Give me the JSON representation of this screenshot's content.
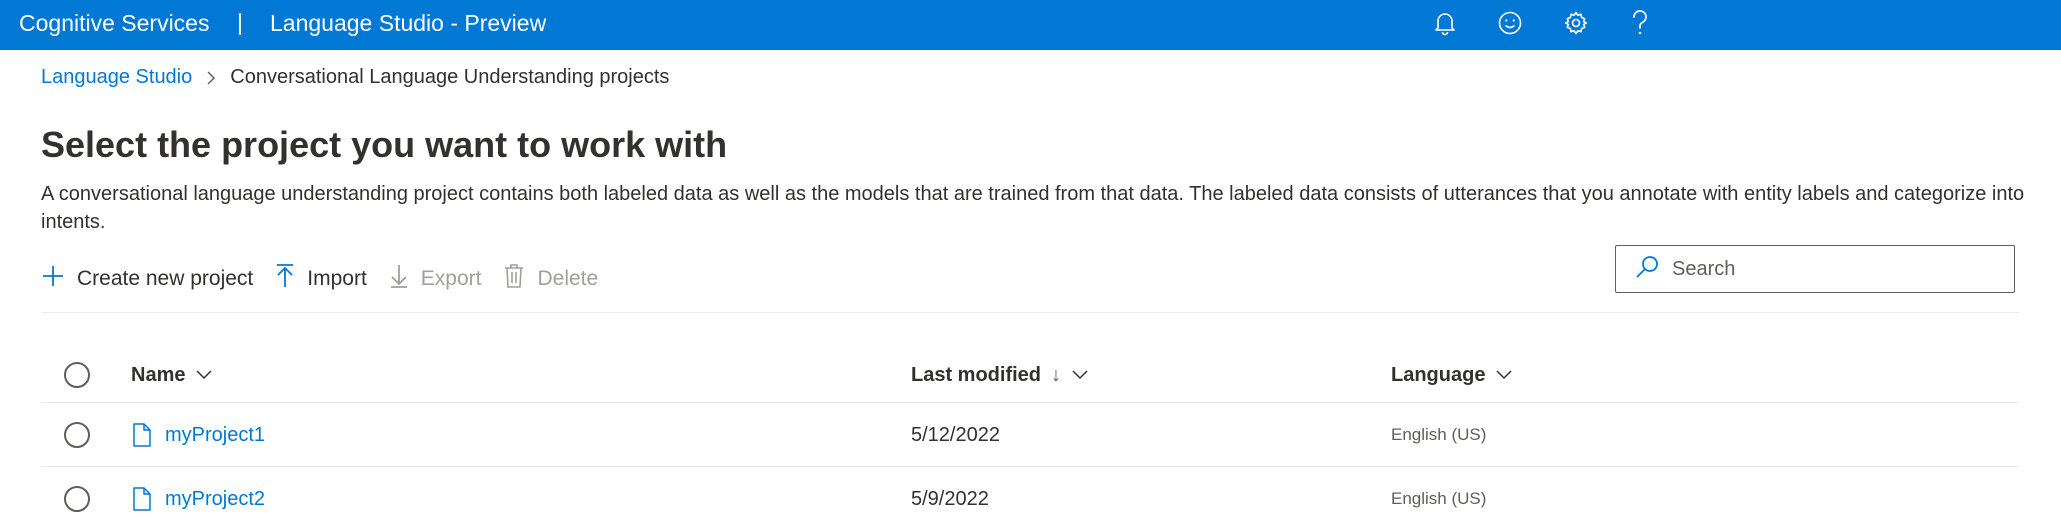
{
  "topbar": {
    "brand": "Cognitive Services",
    "divider": "|",
    "product": "Language Studio - Preview",
    "icons": [
      "bell-icon",
      "smiley-icon",
      "gear-icon",
      "help-icon"
    ],
    "background": "#0078d4"
  },
  "breadcrumb": {
    "root": "Language Studio",
    "current": "Conversational Language Understanding projects"
  },
  "page": {
    "title": "Select the project you want to work with",
    "description": "A conversational language understanding project contains both labeled data as well as the models that are trained from that data. The labeled data consists of utterances that you annotate with entity labels and categorize into intents."
  },
  "commands": {
    "create": "Create new project",
    "import": "Import",
    "export": "Export",
    "delete": "Delete"
  },
  "search": {
    "placeholder": "Search",
    "value": ""
  },
  "table": {
    "columns": {
      "name": "Name",
      "modified": "Last modified",
      "modified_sort": "↓",
      "language": "Language"
    },
    "rows": [
      {
        "name": "myProject1",
        "modified": "5/12/2022",
        "language": "English (US)"
      },
      {
        "name": "myProject2",
        "modified": "5/9/2022",
        "language": "English (US)"
      }
    ]
  },
  "colors": {
    "accent": "#0078d4",
    "disabled": "#a19f9d"
  }
}
